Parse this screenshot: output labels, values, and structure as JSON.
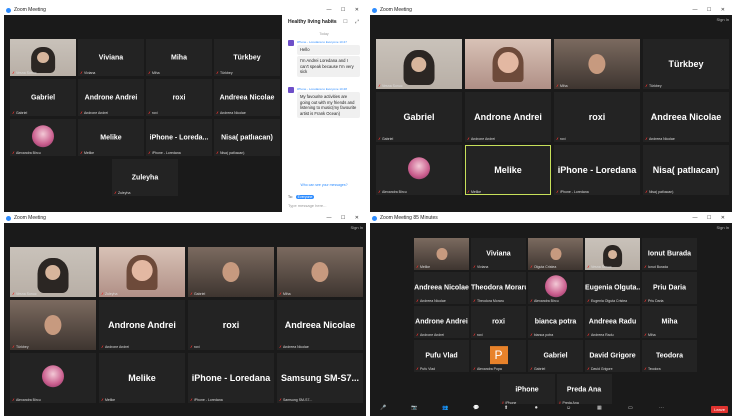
{
  "win1": {
    "title": "Zoom Meeting",
    "sign_in": "Sign In",
    "tiles": [
      {
        "name": "Vesna Sonuc",
        "label": "Vesna Sonuc",
        "video": "hijab"
      },
      {
        "name": "Viviana",
        "label": "Viviana"
      },
      {
        "name": "Miha",
        "label": "Miha"
      },
      {
        "name": "Türkbey",
        "label": "Türkbey"
      },
      {
        "name": "Gabriel",
        "label": "Gabriel"
      },
      {
        "name": "Androne Andrei",
        "label": "Androne Andrei"
      },
      {
        "name": "roxi",
        "label": "roxi"
      },
      {
        "name": "Andreea Nicolae",
        "label": "Andreea Nicolae"
      },
      {
        "name": "Alexandra Bircu",
        "label": "Alexandra Bircu",
        "video": "avatar"
      },
      {
        "name": "Melike",
        "label": "Melike"
      },
      {
        "name": "iPhone - Loreda...",
        "label": "iPhone - Loredana"
      },
      {
        "name": "Nisa( patlıacan)",
        "label": "Nisa( patlıacan)"
      },
      {
        "name": "Zuleyha",
        "label": "Zuleyha"
      }
    ],
    "chat": {
      "title": "Healthy living habits",
      "today": "Today",
      "messages": [
        {
          "from": "iPhone - Loredana to Everyone 10:47",
          "text": "Hello"
        },
        {
          "from": "iPhone - Loredana to Everyone 10:47",
          "text": "I'm Andrei Loredana and I can't speak because I'm very sick"
        },
        {
          "from": "iPhone - Loredana to Everyone 10:48",
          "text": "My favourite activities are going out with my friends and listening to music(my favourite artist is Frank Ocean)"
        }
      ],
      "who_can_see": "Who can see your messages?",
      "to_label": "To:",
      "to_value": "Everyone",
      "placeholder": "Type message here..."
    }
  },
  "win2": {
    "title": "Zoom Meeting",
    "sign_in": "Sign In",
    "tiles": [
      {
        "name": "Vesna Sonuc",
        "label": "Vesna Sonuc",
        "video": "hijab"
      },
      {
        "name": "Viviana",
        "label": "",
        "video": "girl"
      },
      {
        "name": "Miha",
        "label": "Miha",
        "video": "room"
      },
      {
        "name": "Türkbey",
        "label": "Türkbey"
      },
      {
        "name": "Gabriel",
        "label": "Gabriel"
      },
      {
        "name": "Androne Andrei",
        "label": "Androne Andrei"
      },
      {
        "name": "roxi",
        "label": "roxi"
      },
      {
        "name": "Andreea Nicolae",
        "label": "Andreea Nicolae"
      },
      {
        "name": "Alexandra Bircu",
        "label": "Alexandra Bircu",
        "video": "avatar"
      },
      {
        "name": "Melike",
        "label": "Melike"
      },
      {
        "name": "iPhone - Loredana",
        "label": "iPhone - Loredana"
      },
      {
        "name": "Nisa( patlıacan)",
        "label": "Nisa( patlıacan)"
      }
    ]
  },
  "win3": {
    "title": "Zoom Meeting",
    "sign_in": "Sign In",
    "tiles": [
      {
        "name": "Vesna Sonuc",
        "label": "Vesna Sonuc",
        "video": "hijab"
      },
      {
        "name": "Zuleyha",
        "label": "Zuleyha",
        "video": "girl"
      },
      {
        "name": "Gabriel",
        "label": "Gabriel",
        "video": "room"
      },
      {
        "name": "Miha",
        "label": "Miha",
        "video": "room"
      },
      {
        "name": "Türkbey",
        "label": "Türkbey",
        "video": "room"
      },
      {
        "name": "Androne Andrei",
        "label": "Androne Andrei"
      },
      {
        "name": "roxi",
        "label": "roxi"
      },
      {
        "name": "Andreea Nicolae",
        "label": "Andreea Nicolae"
      },
      {
        "name": "Alexandra Bircu",
        "label": "Alexandra Bircu",
        "video": "avatar"
      },
      {
        "name": "Melike",
        "label": "Melike"
      },
      {
        "name": "iPhone - Loredana",
        "label": "iPhone - Loredana"
      },
      {
        "name": "Samsung SM-S7...",
        "label": "Samsung SM-S7..."
      }
    ]
  },
  "win4": {
    "title": "Zoom Meeting 85 Minutes",
    "sign_in": "Sign In",
    "tiles": [
      {
        "name": "Melike",
        "label": "Melike",
        "video": "room"
      },
      {
        "name": "Viviana",
        "label": "Viviana"
      },
      {
        "name": "Olguta Cristea",
        "label": "Olguta Cristea",
        "video": "room"
      },
      {
        "name": "Vesna Sonuc",
        "label": "Vesna Sonuc",
        "video": "hijab"
      },
      {
        "name": "Ionut Burada",
        "label": "Ionut Burada"
      },
      {
        "name": "Andreea Nicolae",
        "label": "Andreea Nicolae"
      },
      {
        "name": "Theodora Moraru",
        "label": "Theodora Moraru"
      },
      {
        "name": "Alexandra Bircu",
        "label": "Alexandra Bircu",
        "video": "avatar"
      },
      {
        "name": "Eugenia Olguta...",
        "label": "Eugenia Olguta Cristea"
      },
      {
        "name": "Priu Daria",
        "label": "Priu Daria"
      },
      {
        "name": "Androne Andrei",
        "label": "Androne Andrei"
      },
      {
        "name": "roxi",
        "label": "roxi"
      },
      {
        "name": "bianca potra",
        "label": "bianca potra"
      },
      {
        "name": "Andreea Radu",
        "label": "Andreea Radu"
      },
      {
        "name": "Miha",
        "label": "Miha"
      },
      {
        "name": "Pufu Vlad",
        "label": "Pufu Vlad"
      },
      {
        "name": "P",
        "label": "Alexandra Popa",
        "video": "letter"
      },
      {
        "name": "Gabriel",
        "label": "Gabriel"
      },
      {
        "name": "David Grigore",
        "label": "David Grigore"
      },
      {
        "name": "Teodora",
        "label": "Teodora"
      },
      {
        "name": "iPhone",
        "label": "iPhone"
      },
      {
        "name": "Preda Ana",
        "label": "Preda Ana"
      }
    ],
    "toolbar": {
      "items": [
        "Unmute",
        "Start Video",
        "Participants",
        "Chat",
        "Share Screen",
        "Record",
        "Reactions",
        "Apps",
        "Whiteboards",
        "More"
      ],
      "leave": "Leave"
    }
  }
}
